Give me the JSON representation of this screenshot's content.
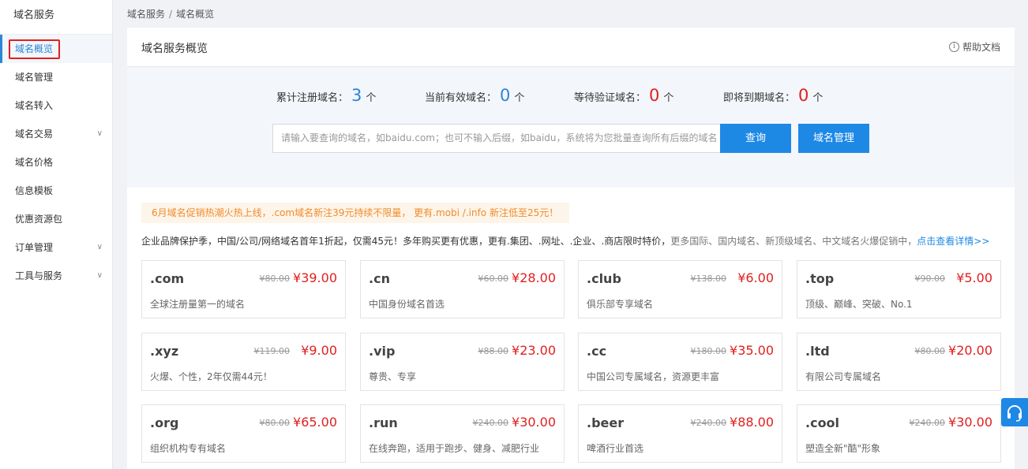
{
  "sidebar": {
    "title": "域名服务",
    "items": [
      {
        "label": "域名概览",
        "expand": false
      },
      {
        "label": "域名管理",
        "expand": false
      },
      {
        "label": "域名转入",
        "expand": false
      },
      {
        "label": "域名交易",
        "expand": true
      },
      {
        "label": "域名价格",
        "expand": false
      },
      {
        "label": "信息模板",
        "expand": false
      },
      {
        "label": "优惠资源包",
        "expand": false
      },
      {
        "label": "订单管理",
        "expand": true
      },
      {
        "label": "工具与服务",
        "expand": true
      }
    ],
    "active_index": 0
  },
  "breadcrumb": {
    "root": "域名服务",
    "sep": "/",
    "current": "域名概览"
  },
  "panel": {
    "title": "域名服务概览",
    "help_label": "帮助文档",
    "help_icon": "info-icon"
  },
  "stats": [
    {
      "label": "累计注册域名：",
      "value": "3",
      "unit": "个",
      "color": "#2a86d8"
    },
    {
      "label": "当前有效域名：",
      "value": "0",
      "unit": "个",
      "color": "#2a86d8"
    },
    {
      "label": "等待验证域名：",
      "value": "0",
      "unit": "个",
      "color": "#e02020"
    },
    {
      "label": "即将到期域名：",
      "value": "0",
      "unit": "个",
      "color": "#e02020"
    }
  ],
  "search": {
    "placeholder": "请输入要查询的域名，如baidu.com；也可不输入后缀，如baidu，系统将为您批量查询所有后缀的域名",
    "query_label": "查询",
    "manage_label": "域名管理"
  },
  "promo": {
    "banner": "6月域名促销热潮火热上线，.com域名新注39元持续不限量， 更有.mobi /.info 新注低至25元！",
    "line_main": "企业品牌保护季，中国/公司/网络域名首年1折起，仅需45元！多年购买更有优惠，更有.集团、.网址、.企业、.商店限时特价，",
    "line_gray": "更多国际、国内域名、新顶级域名、中文域名火爆促销中，",
    "line_link": "点击查看详情>>"
  },
  "cards": [
    {
      "tld": ".com",
      "old": "¥80.00",
      "new": "¥39.00",
      "desc": "全球注册量第一的域名"
    },
    {
      "tld": ".cn",
      "old": "¥60.00",
      "new": "¥28.00",
      "desc": "中国身份域名首选"
    },
    {
      "tld": ".club",
      "old": "¥138.00",
      "new": "¥6.00",
      "desc": "俱乐部专享域名"
    },
    {
      "tld": ".top",
      "old": "¥90.00",
      "new": "¥5.00",
      "desc": "顶级、巅峰、突破、No.1"
    },
    {
      "tld": ".xyz",
      "old": "¥119.00",
      "new": "¥9.00",
      "desc": "火爆、个性，2年仅需44元！"
    },
    {
      "tld": ".vip",
      "old": "¥88.00",
      "new": "¥23.00",
      "desc": "尊贵、专享"
    },
    {
      "tld": ".cc",
      "old": "¥180.00",
      "new": "¥35.00",
      "desc": "中国公司专属域名，资源更丰富"
    },
    {
      "tld": ".ltd",
      "old": "¥80.00",
      "new": "¥20.00",
      "desc": "有限公司专属域名"
    },
    {
      "tld": ".org",
      "old": "¥80.00",
      "new": "¥65.00",
      "desc": "组织机构专有域名"
    },
    {
      "tld": ".run",
      "old": "¥240.00",
      "new": "¥30.00",
      "desc": "在线奔跑，适用于跑步、健身、减肥行业"
    },
    {
      "tld": ".beer",
      "old": "¥240.00",
      "new": "¥88.00",
      "desc": "啤酒行业首选"
    },
    {
      "tld": ".cool",
      "old": "¥240.00",
      "new": "¥30.00",
      "desc": "塑造全新\"酷\"形象"
    }
  ],
  "float_button": {
    "icon": "headset-icon",
    "color": "#1e88e5"
  }
}
